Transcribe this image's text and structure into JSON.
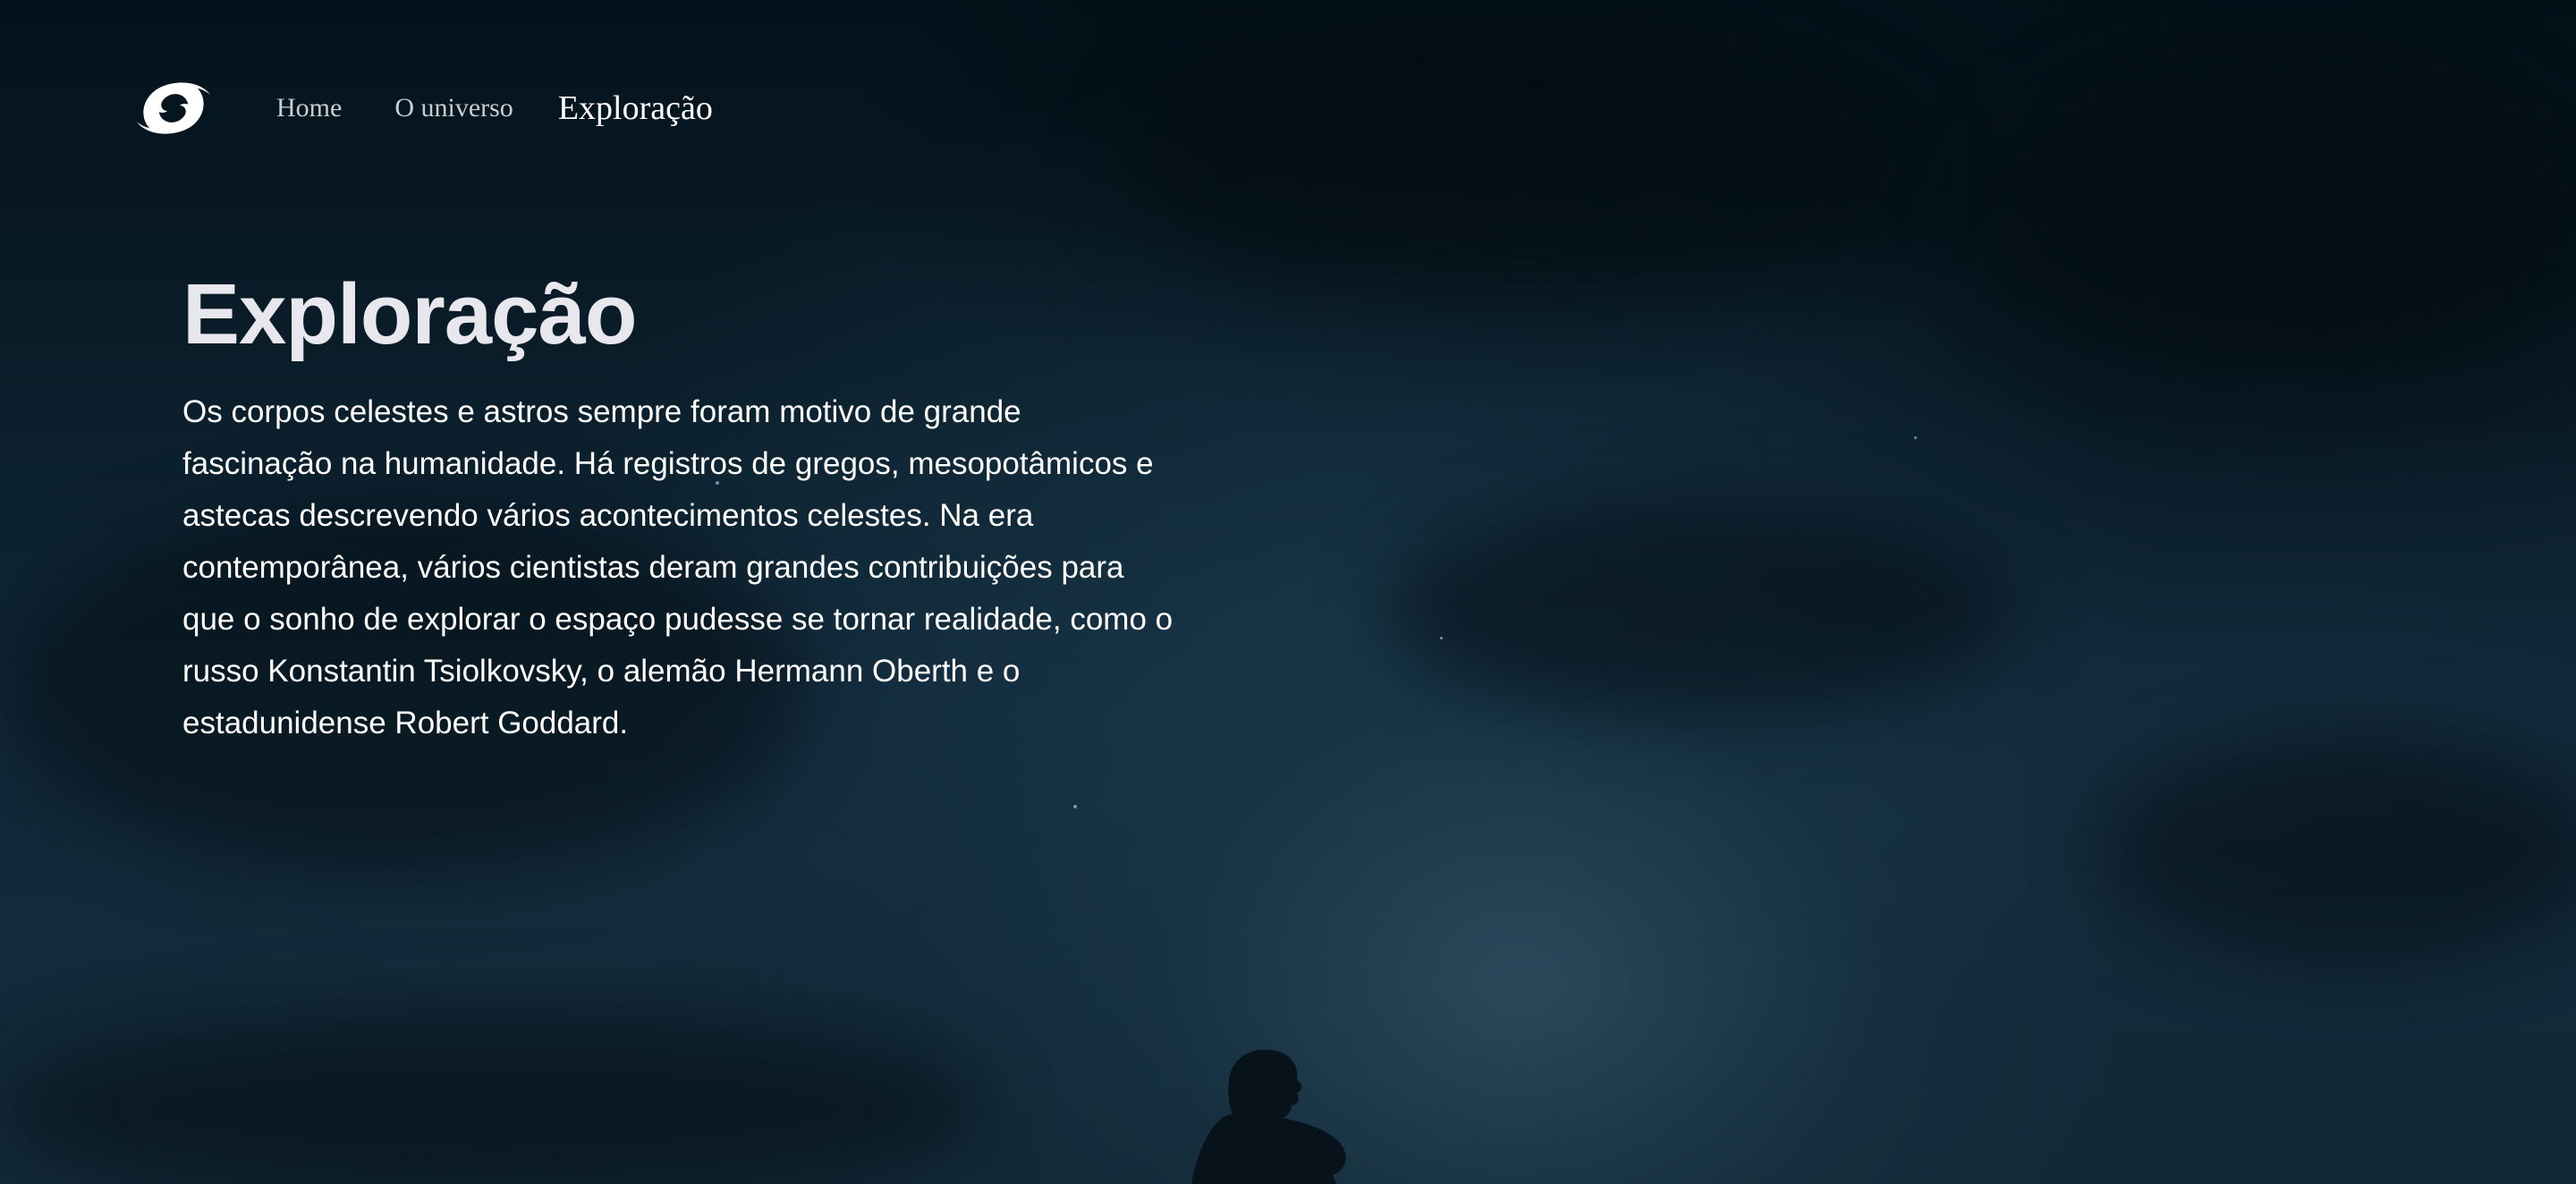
{
  "nav": {
    "logo_icon": "galaxy-swirl-icon",
    "items": [
      {
        "label": "Home"
      },
      {
        "label": "O universo"
      },
      {
        "label": "Exploração",
        "active": true
      }
    ]
  },
  "hero": {
    "title": "Exploração",
    "paragraph": "Os corpos celestes e astros sempre foram motivo de grande fascinação na humanidade. Há registros de gregos, mesopotâmicos e astecas descrevendo vários acontecimentos celestes. Na era contemporânea, vários cientistas deram grandes contribuições para que o sonho de explorar o espaço pudesse se tornar realidade, como o russo Konstantin Tsiolkovsky, o alemão Hermann Oberth e o estadunidense Robert Goddard."
  },
  "colors": {
    "background": "#0d1e2a",
    "title": "#e8e7ee",
    "text": "#ffffff",
    "nav_inactive": "#c9cdd2"
  }
}
